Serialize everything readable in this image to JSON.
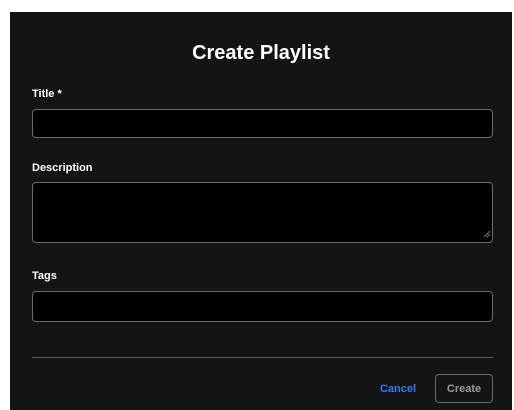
{
  "dialog": {
    "title": "Create Playlist",
    "fields": {
      "title": {
        "label": "Title *",
        "value": "",
        "placeholder": ""
      },
      "description": {
        "label": "Description",
        "value": "",
        "placeholder": ""
      },
      "tags": {
        "label": "Tags",
        "value": "",
        "placeholder": ""
      }
    },
    "actions": {
      "cancel_label": "Cancel",
      "create_label": "Create"
    }
  },
  "colors": {
    "background": "#141414",
    "field_background": "#000000",
    "field_border": "#6a6a6a",
    "accent": "#2f7cf6",
    "disabled_text": "#9a9a9a"
  }
}
